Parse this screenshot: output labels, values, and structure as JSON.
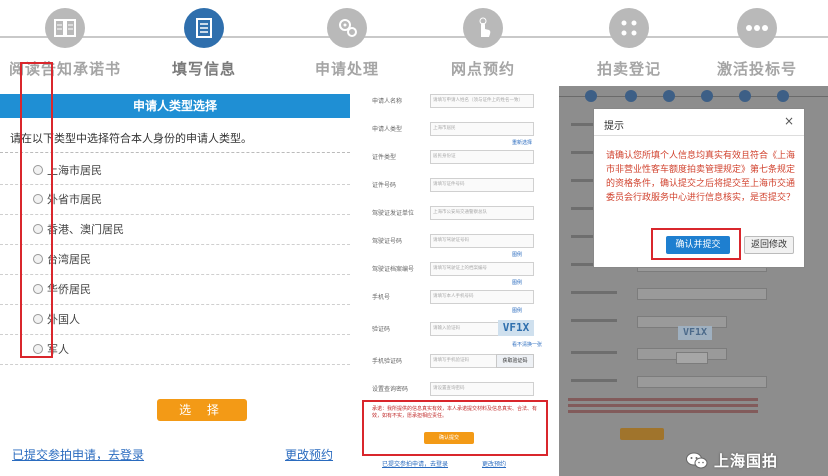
{
  "steps": [
    {
      "label": "阅读告知承诺书",
      "icon": "book-icon",
      "active": false
    },
    {
      "label": "填写信息",
      "icon": "document-icon",
      "active": true
    },
    {
      "label": "申请处理",
      "icon": "gear-processing-icon",
      "active": false
    },
    {
      "label": "网点预约",
      "icon": "tap-hand-icon",
      "active": false
    },
    {
      "label": "拍卖登记",
      "icon": "dots-icon",
      "active": false
    },
    {
      "label": "激活投标号",
      "icon": "ellipsis-icon",
      "active": false
    }
  ],
  "left": {
    "header": "申请人类型选择",
    "instruction": "请在以下类型中选择符合本人身份的申请人类型。",
    "options": [
      "上海市居民",
      "外省市居民",
      "香港、澳门居民",
      "台湾居民",
      "华侨居民",
      "外国人",
      "军人"
    ],
    "select_button": "选 择",
    "link_login": "已提交参拍申请，去登录",
    "link_change": "更改预约"
  },
  "mid": {
    "fields": [
      {
        "label": "申请人名称",
        "placeholder": "请填写申请人姓名（须与证件上的姓名一致）"
      },
      {
        "label": "申请人类型",
        "placeholder": "上海市居民",
        "note": "重新选择"
      },
      {
        "label": "证件类型",
        "placeholder": "居民身份证"
      },
      {
        "label": "证件号码",
        "placeholder": "请填写证件号码"
      },
      {
        "label": "驾驶证发证单位",
        "placeholder": "上海市公安局交通警察总队"
      },
      {
        "label": "驾驶证号码",
        "placeholder": "请填写驾驶证号码",
        "note": "图例"
      },
      {
        "label": "驾驶证档案编号",
        "placeholder": "请填写驾驶证上的档案编号",
        "note": "图例"
      },
      {
        "label": "手机号",
        "placeholder": "请填写本人手机号码",
        "note": "图例"
      },
      {
        "label": "验证码",
        "placeholder": "请输入验证码",
        "note": "看不清换一张"
      },
      {
        "label": "手机验证码",
        "placeholder": "请填写手机验证码",
        "note": "获取验证码"
      },
      {
        "label": "设置查询密码",
        "placeholder": "请设置查询密码"
      }
    ],
    "captcha": "VF1X",
    "sms_button": "获取验证码",
    "agreement": "承诺：我所提供的信息真实有效，本人承诺提交材料及信息真实、合法、有效，如有不实，愿承担相应责任。",
    "confirm_button": "确认提交",
    "link_login": "已提交参拍申请，去登录",
    "link_change": "更改预约"
  },
  "right": {
    "captcha": "VF1X",
    "dialog": {
      "title": "提示",
      "close": "×",
      "message": "请确认您所填个人信息均真实有效且符合《上海市非营业性客车额度拍卖管理规定》第七条规定的资格条件，确认提交之后将提交至上海市交通委员会行政服务中心进行信息核实，是否提交？",
      "confirm_button": "确认并提交",
      "back_button": "返回修改"
    }
  },
  "watermark": {
    "text": "上海国拍",
    "icon": "wechat-logo-icon"
  },
  "colors": {
    "accent": "#1f8fd4",
    "step_active": "#2f6fad",
    "orange": "#f39a16",
    "highlight": "#d9262c",
    "alert_text": "#d1432f"
  }
}
